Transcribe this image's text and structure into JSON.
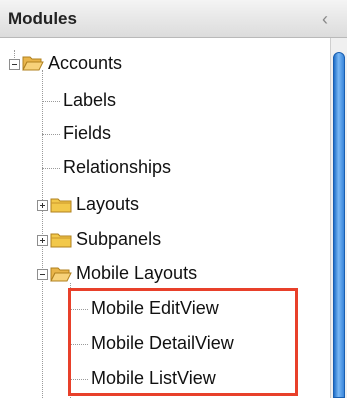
{
  "header": {
    "title": "Modules",
    "collapse_label": "‹"
  },
  "tree": {
    "accounts": "Accounts",
    "labels": "Labels",
    "fields": "Fields",
    "relationships": "Relationships",
    "layouts": "Layouts",
    "subpanels": "Subpanels",
    "mobile_layouts": "Mobile Layouts",
    "mobile_editview": "Mobile EditView",
    "mobile_detailview": "Mobile DetailView",
    "mobile_listview": "Mobile ListView"
  },
  "colors": {
    "highlight": "#e8402a",
    "scroll_thumb": "#3a86dc"
  }
}
